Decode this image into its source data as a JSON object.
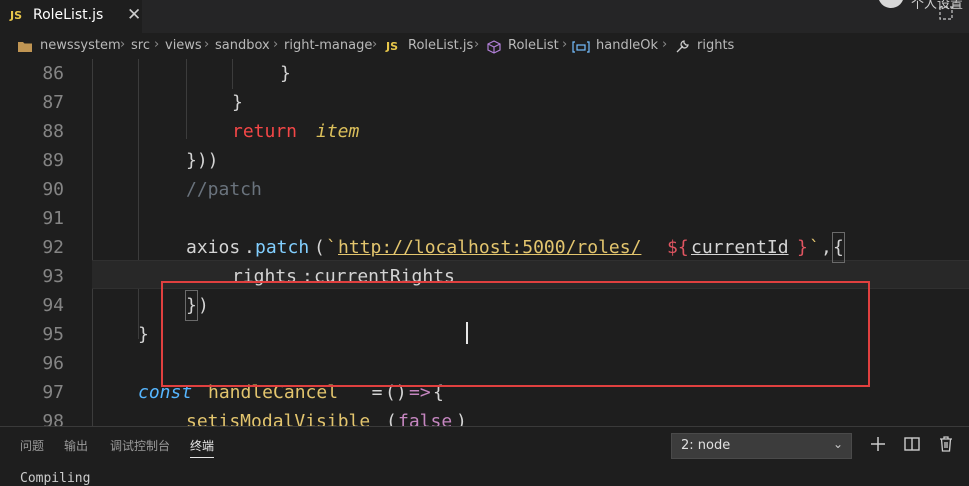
{
  "tab": {
    "badge": "JS",
    "title": "RoleList.js",
    "close": "✕"
  },
  "top_right": {
    "text": "个人设置"
  },
  "breadcrumb": {
    "items": [
      "newssystem",
      "src",
      "views",
      "sandbox",
      "right-manage",
      "RoleList.js",
      "RoleList",
      "handleOk",
      "rights"
    ],
    "separator": "›",
    "js_badge": "JS"
  },
  "editor": {
    "lines": [
      {
        "num": "86"
      },
      {
        "num": "87"
      },
      {
        "num": "88"
      },
      {
        "num": "89"
      },
      {
        "num": "90"
      },
      {
        "num": "91"
      },
      {
        "num": "92"
      },
      {
        "num": "93"
      },
      {
        "num": "94"
      },
      {
        "num": "95"
      },
      {
        "num": "96"
      },
      {
        "num": "97"
      },
      {
        "num": "98"
      }
    ],
    "tokens": {
      "l86_brace": "}",
      "l87_brace": "}",
      "l88_return": "return",
      "l88_item": "item",
      "l89": "}))",
      "l90": "//patch",
      "l92_axios": "axios",
      "l92_dot": ".",
      "l92_patch": "patch",
      "l92_paren": "(",
      "l92_tick": "`",
      "l92_url": "http://localhost:5000/roles/",
      "l92_dollar": "${",
      "l92_var": "currentId",
      "l92_close": "}",
      "l92_tick2": "`",
      "l92_comma": ",",
      "l92_obj": "{",
      "l93_key": "rights",
      "l93_colon": ":",
      "l93_val": "currentRights",
      "l94_brace": "}",
      "l94_paren": ")",
      "l95": "}",
      "l97_const": "const",
      "l97_name": "handleCancel",
      "l97_eq": "  =",
      "l97_parens": "()",
      "l97_arrow": "=>",
      "l97_brace": "{",
      "l98_fn": "setisModalVisible",
      "l98_open": "(",
      "l98_false": "false",
      "l98_close": ")"
    }
  },
  "panel": {
    "tabs": [
      "问题",
      "输出",
      "调试控制台",
      "终端"
    ],
    "active_tab": "终端",
    "terminal_select": "2: node",
    "terminal_output": "Compiling"
  },
  "colors": {
    "keyword": "#c586c0",
    "return_kw": "#f44747",
    "variable": "#9cdcfe",
    "function": "#dcdcaa",
    "string": "#ce9178",
    "comment": "#6a9955",
    "storage": "#569cd6",
    "highlight_box": "#e0403f"
  }
}
